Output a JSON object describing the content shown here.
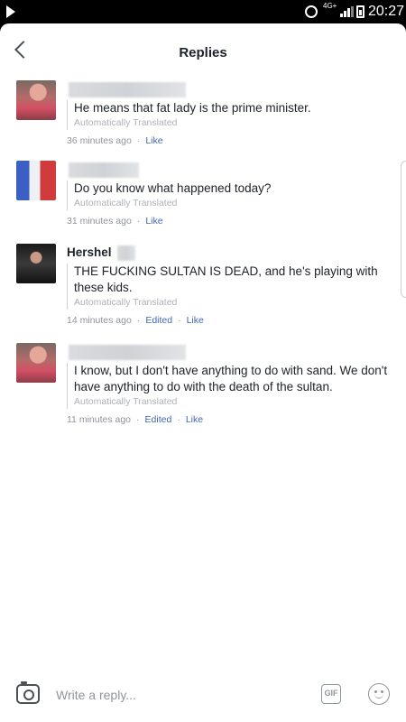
{
  "status_bar": {
    "time": "20:27",
    "network": "4G+",
    "icons": [
      "play-icon",
      "alarm-icon",
      "signal-icon",
      "battery-icon"
    ]
  },
  "header": {
    "title": "Replies",
    "back_icon": "chevron-left-icon"
  },
  "comments": [
    {
      "name": "",
      "text": "He means that fat lady is the prime minister.",
      "translated": "Automatically Translated",
      "time": "36 minutes ago",
      "edited": "",
      "like": "Like"
    },
    {
      "name": "",
      "text": "Do you know what happened today?",
      "translated": "Automatically Translated",
      "time": "31 minutes ago",
      "edited": "",
      "like": "Like"
    },
    {
      "name": "Hershel",
      "text": "THE FUCKING SULTAN IS DEAD, and he's playing with these kids.",
      "translated": "Automatically Translated",
      "time": "14 minutes ago",
      "edited": "Edited",
      "like": "Like"
    },
    {
      "name": "",
      "text": "I know, but I don't have anything to do with sand. We don't have anything to do with the death of the sultan.",
      "translated": "Automatically Translated",
      "time": "11 minutes ago",
      "edited": "Edited",
      "like": "Like"
    }
  ],
  "composer": {
    "placeholder": "Write a reply...",
    "gif_label": "GIF",
    "icons": [
      "camera-icon",
      "gif-icon",
      "emoji-icon"
    ]
  },
  "colors": {
    "link": "#4267b2",
    "meta": "#90949c",
    "text": "#1d2129"
  }
}
